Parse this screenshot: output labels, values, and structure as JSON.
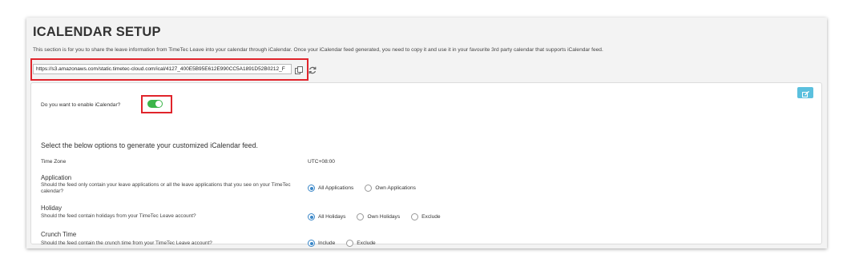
{
  "page": {
    "title": "ICALENDAR SETUP",
    "description": "This section is for you to share the leave information from TimeTec Leave into your calendar through iCalendar. Once your iCalendar feed generated, you need to copy it and use it in your favourite 3rd party calendar that supports iCalendar feed."
  },
  "feed": {
    "url": "https://s3.amazonaws.com/static.timetec-cloud.com/ical/4127_400E5B95E612E990CC5A1891D52B0212_F",
    "copy_icon": "copy-icon",
    "refresh_icon": "refresh-icon"
  },
  "settings": {
    "edit_icon": "edit-icon",
    "enable_label": "Do you want to enable iCalendar?",
    "enabled": true,
    "subheading": "Select the below options to generate your customized iCalendar feed.",
    "timezone_label": "Time Zone",
    "timezone_value": "UTC+08:00",
    "application": {
      "title": "Application",
      "desc": "Should the feed only contain your leave applications or all the leave applications that you see on your TimeTec calendar?",
      "options": [
        "All Applications",
        "Own Applications"
      ],
      "selected": "All Applications"
    },
    "holiday": {
      "title": "Holiday",
      "desc": "Should the feed contain holidays from your TimeTec Leave account?",
      "options": [
        "All Holidays",
        "Own Holidays",
        "Exclude"
      ],
      "selected": "All Holidays"
    },
    "crunch": {
      "title": "Crunch Time",
      "desc": "Should the feed contain the crunch time from your TimeTec Leave account?",
      "options": [
        "Include",
        "Exclude"
      ],
      "selected": "Include"
    }
  },
  "colors": {
    "highlight": "#e0242b",
    "toggle_on": "#3cb54a",
    "radio_accent": "#3a87c8",
    "edit_button": "#5bc0de"
  }
}
